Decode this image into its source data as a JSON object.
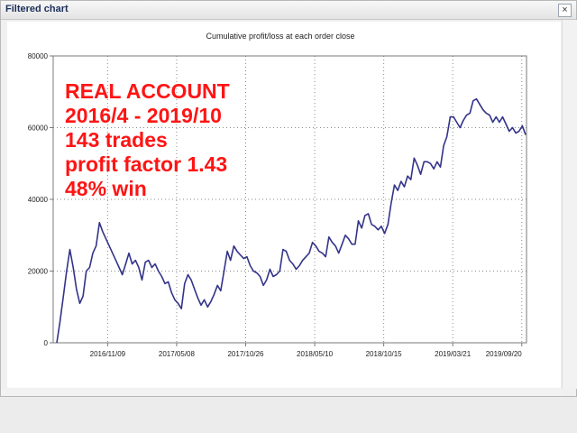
{
  "window": {
    "title": "Filtered chart",
    "close_glyph": "×"
  },
  "overlay_text": [
    "REAL ACCOUNT",
    "2016/4 - 2019/10",
    "143 trades",
    "profit factor 1.43",
    "48% win"
  ],
  "chart_data": {
    "type": "line",
    "title": "Cumulative profit/loss at each order close",
    "xlabel": "",
    "ylabel": "",
    "ylim": [
      0,
      80000
    ],
    "y_ticks": [
      "0",
      "20000",
      "40000",
      "60000",
      "80000"
    ],
    "x_ticks": [
      "2016/11/09",
      "2017/05/08",
      "2017/10/26",
      "2018/05/10",
      "2018/10/15",
      "2019/03/21",
      "2019/09/20"
    ],
    "grid": true,
    "line_color": "#33338a",
    "series": [
      {
        "name": "",
        "values": [
          0,
          6000,
          13000,
          20000,
          26000,
          21000,
          15000,
          11000,
          13000,
          20000,
          21000,
          25000,
          27000,
          33500,
          31000,
          29000,
          27000,
          25000,
          23000,
          21000,
          19000,
          22000,
          25000,
          22000,
          23000,
          21000,
          17500,
          22500,
          23000,
          21000,
          22000,
          20000,
          18500,
          16500,
          17000,
          14000,
          12000,
          11000,
          9500,
          16500,
          19000,
          17500,
          15000,
          12500,
          10500,
          12000,
          10000,
          11500,
          13500,
          16000,
          14500,
          20000,
          25500,
          23000,
          27000,
          25500,
          24500,
          23500,
          24000,
          21500,
          20000,
          19500,
          18500,
          16000,
          17500,
          20500,
          18500,
          19000,
          20000,
          26000,
          25500,
          23000,
          22000,
          20500,
          21500,
          23000,
          24000,
          25000,
          28000,
          27000,
          25500,
          25000,
          24000,
          29500,
          28000,
          27000,
          25000,
          27500,
          30000,
          29000,
          27500,
          27500,
          34000,
          32000,
          35500,
          36000,
          33000,
          32500,
          31500,
          32500,
          30500,
          33000,
          39000,
          44000,
          42500,
          45000,
          43500,
          46500,
          45500,
          51500,
          49500,
          47000,
          50500,
          50500,
          50000,
          48500,
          50500,
          49000,
          55000,
          57500,
          63000,
          63000,
          61500,
          60000,
          62000,
          63500,
          64000,
          67500,
          68000,
          66500,
          65000,
          64000,
          63500,
          61500,
          63000,
          61500,
          63000,
          61000,
          59000,
          60000,
          58500,
          59000,
          60500,
          58000
        ]
      }
    ]
  }
}
